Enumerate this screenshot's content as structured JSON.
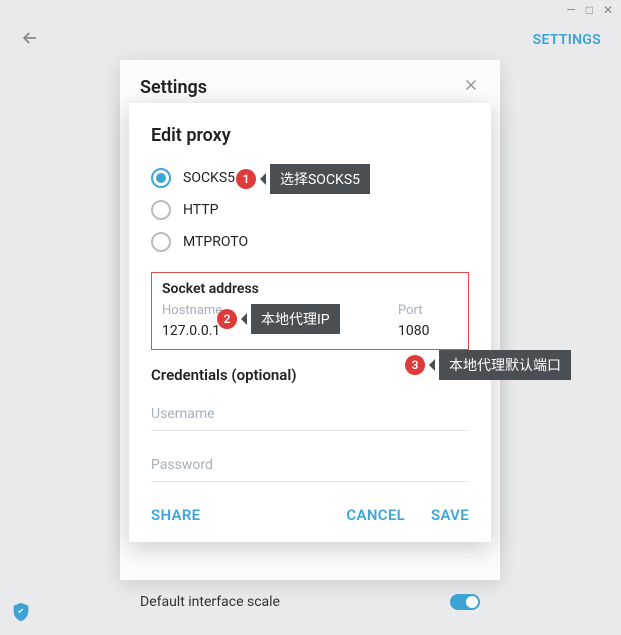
{
  "window": {
    "minimize": "—",
    "maximize": "□",
    "close": "✕"
  },
  "topbar": {
    "settings_link": "SETTINGS"
  },
  "settings_panel": {
    "title": "Settings"
  },
  "proxy_dialog": {
    "title": "Edit proxy",
    "types": {
      "socks5": "SOCKS5",
      "http": "HTTP",
      "mtproto": "MTPROTO"
    },
    "selected_type": "socks5",
    "socket_section": "Socket address",
    "hostname_label": "Hostname",
    "hostname_value": "127.0.0.1",
    "port_label": "Port",
    "port_value": "1080",
    "credentials_section": "Credentials (optional)",
    "username_placeholder": "Username",
    "password_placeholder": "Password",
    "actions": {
      "share": "SHARE",
      "cancel": "CANCEL",
      "save": "SAVE"
    }
  },
  "interface": {
    "label": "Default interface scale",
    "toggle_on": true
  },
  "annotations": {
    "a1": {
      "num": "1",
      "text": "选择SOCKS5"
    },
    "a2": {
      "num": "2",
      "text": "本地代理IP"
    },
    "a3": {
      "num": "3",
      "text": "本地代理默认端口"
    }
  }
}
